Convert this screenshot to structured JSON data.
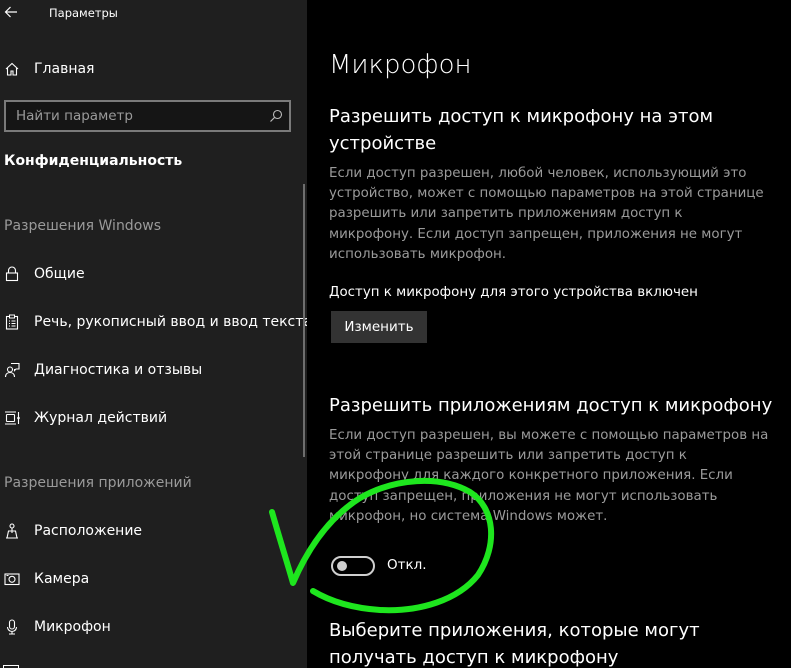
{
  "window": {
    "title": "Параметры",
    "back_icon": "arrow-left-icon"
  },
  "sidebar": {
    "home": {
      "label": "Главная",
      "icon": "home-icon"
    },
    "search": {
      "placeholder": "Найти параметр",
      "value": "",
      "icon": "search-icon"
    },
    "section_title": "Конфиденциальность",
    "groups": [
      {
        "title": "Разрешения Windows",
        "items": [
          {
            "label": "Общие",
            "icon": "lock-icon"
          },
          {
            "label": "Речь, рукописный ввод и ввод текста",
            "icon": "clipboard-icon"
          },
          {
            "label": "Диагностика и отзывы",
            "icon": "feedback-icon"
          },
          {
            "label": "Журнал действий",
            "icon": "timeline-icon"
          }
        ]
      },
      {
        "title": "Разрешения приложений",
        "items": [
          {
            "label": "Расположение",
            "icon": "location-icon"
          },
          {
            "label": "Камера",
            "icon": "camera-icon"
          },
          {
            "label": "Микрофон",
            "icon": "microphone-icon",
            "selected": true
          }
        ]
      }
    ]
  },
  "main": {
    "title": "Микрофон",
    "device_section": {
      "heading": "Разрешить доступ к микрофону на этом устройстве",
      "description": "Если доступ разрешен, любой человек, использующий это устройство, может с помощью параметров на этой странице разрешить или запретить приложениям доступ к микрофону. Если доступ запрещен, приложения не могут использовать микрофон.",
      "status": "Доступ к микрофону для этого устройства включен",
      "button_label": "Изменить"
    },
    "apps_section": {
      "heading": "Разрешить приложениям доступ к микрофону",
      "description": "Если доступ разрешен, вы можете с помощью параметров на этой странице разрешить или запретить доступ к микрофону для каждого конкретного приложения. Если доступ запрещен, приложения не могут использовать микрофон, но система Windows может.",
      "toggle_state": false,
      "toggle_label": "Откл."
    },
    "choose_apps_section": {
      "heading": "Выберите приложения, которые могут получать доступ к микрофону"
    }
  },
  "annotation": {
    "type": "hand-drawn checkmark and circle",
    "color": "#1ee61e"
  }
}
